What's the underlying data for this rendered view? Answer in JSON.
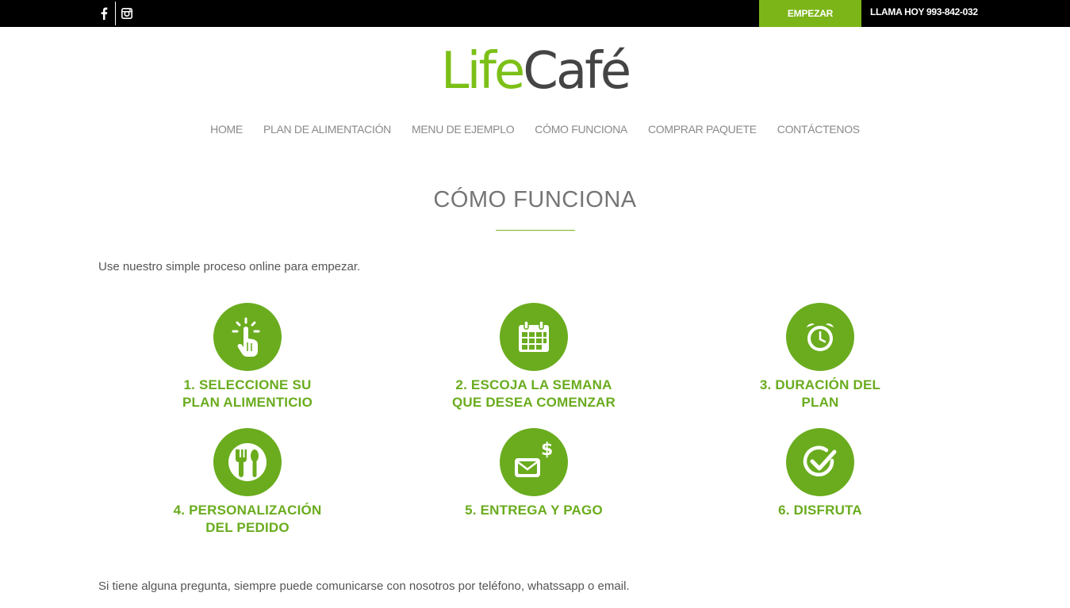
{
  "topbar": {
    "social": [
      {
        "icon": "facebook-icon"
      },
      {
        "icon": "instagram-icon"
      }
    ],
    "cta_label": "EMPEZAR",
    "phone_text": "LLAMA HOY 993-842-032"
  },
  "logo": {
    "part1": "Life",
    "part2": "Café"
  },
  "nav": {
    "items": [
      {
        "label": "HOME"
      },
      {
        "label": "PLAN DE ALIMENTACIÓN"
      },
      {
        "label": "MENU DE EJEMPLO"
      },
      {
        "label": "CÓMO FUNCIONA"
      },
      {
        "label": "COMPRAR PAQUETE"
      },
      {
        "label": "CONTÁCTENOS"
      }
    ]
  },
  "page": {
    "title": "CÓMO FUNCIONA",
    "intro": "Use nuestro simple proceso online para empezar.",
    "outro": "Si tiene alguna pregunta, siempre puede comunicarse con nosotros por teléfono, whatssapp o email."
  },
  "steps": [
    {
      "line1": "1. SELECCIONE SU",
      "line2": "PLAN ALIMENTICIO",
      "icon": "tap-finger-icon"
    },
    {
      "line1": "2. ESCOJA LA SEMANA",
      "line2": "QUE DESEA COMENZAR",
      "icon": "calendar-icon"
    },
    {
      "line1": "3. DURACIÓN DEL",
      "line2": "PLAN",
      "icon": "alarm-clock-icon"
    },
    {
      "line1": "4. PERSONALIZACIÓN",
      "line2": "DEL PEDIDO",
      "icon": "plate-cutlery-icon"
    },
    {
      "line1": "5. ENTREGA Y PAGO",
      "line2": "",
      "icon": "envelope-dollar-icon"
    },
    {
      "line1": "6. DISFRUTA",
      "line2": "",
      "icon": "check-circle-icon"
    }
  ],
  "colors": {
    "accent": "#7cb518",
    "step_green": "#6aac1e",
    "topbar_bg": "#000000"
  }
}
